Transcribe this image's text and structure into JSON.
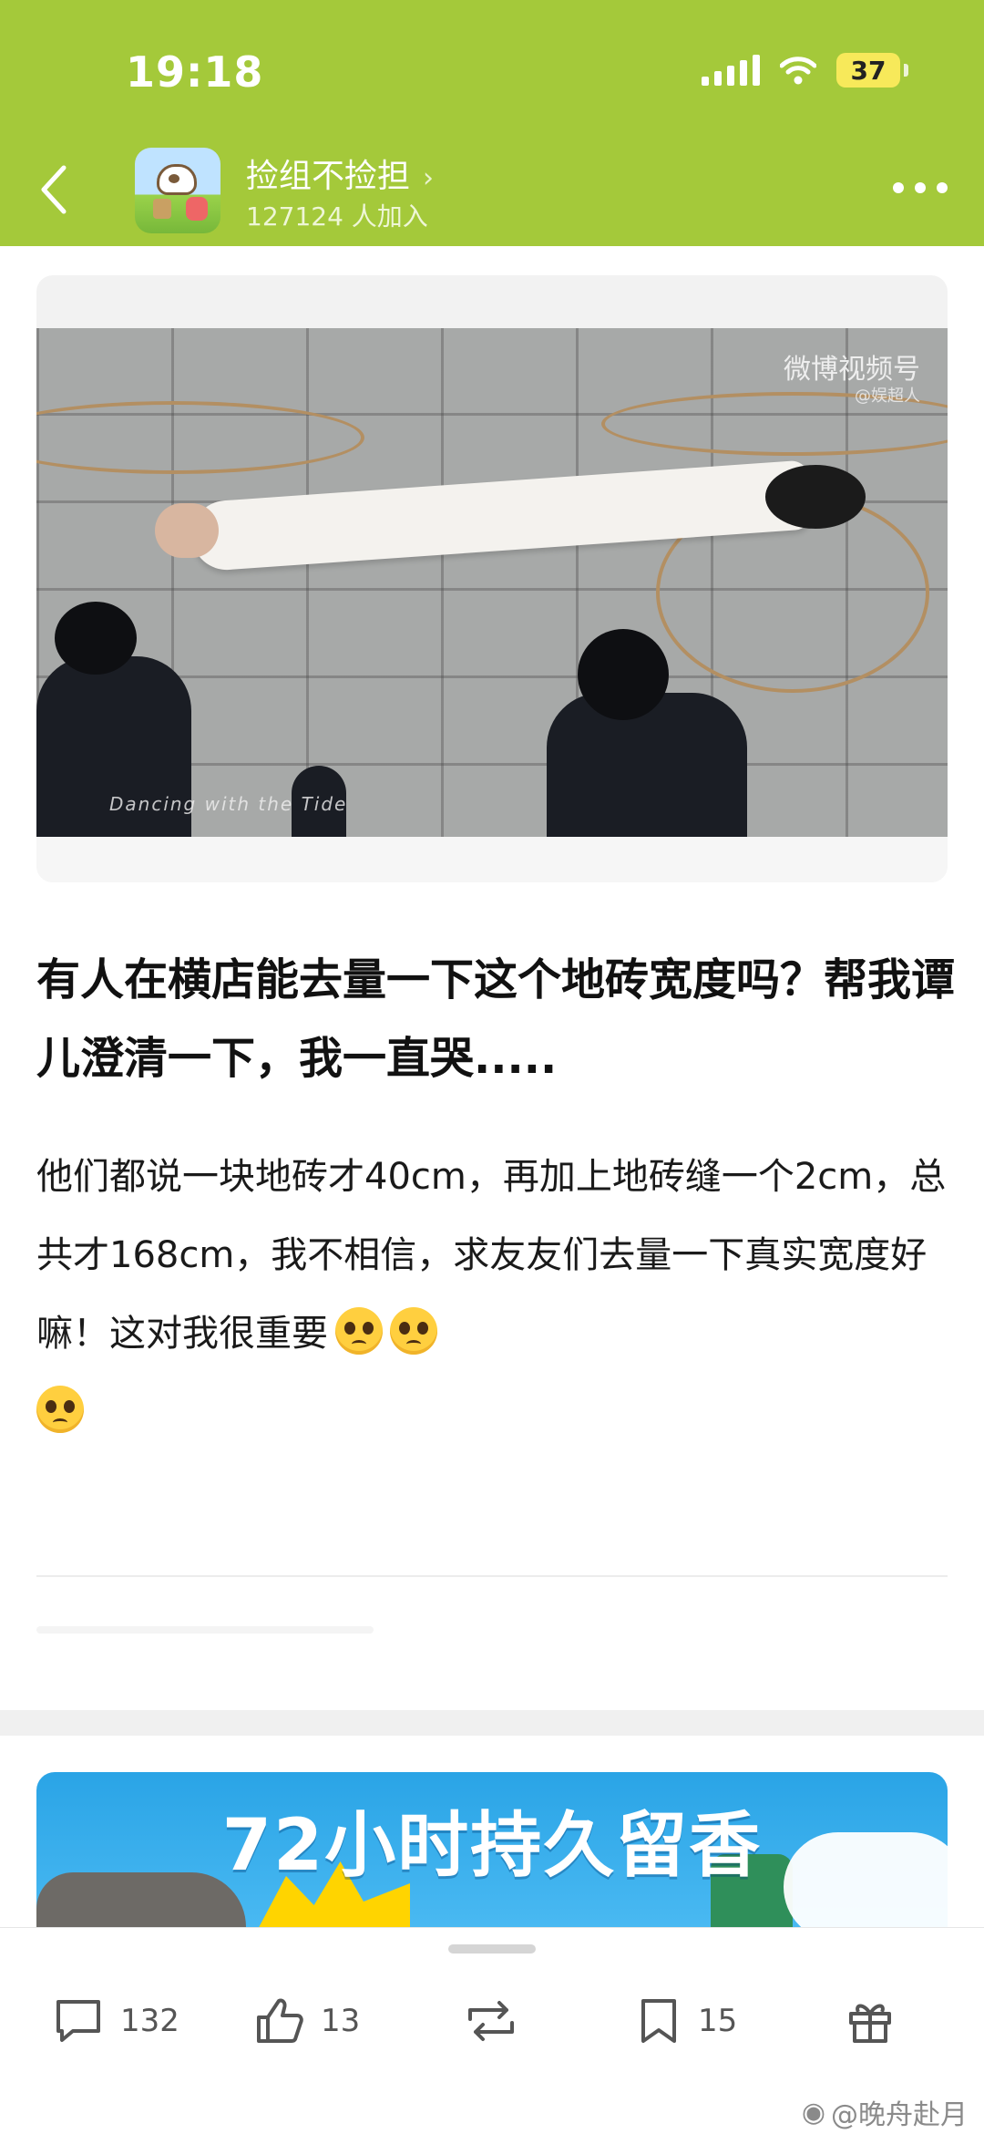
{
  "status_bar": {
    "time": "19:18",
    "battery": "37"
  },
  "group": {
    "name": "捡组不捡担",
    "member_count": "127124 人加入"
  },
  "media": {
    "watermark_brand": "微博视频号",
    "watermark_sub": "@娱超人",
    "photo_caption": "Dancing with the Tide"
  },
  "post": {
    "title": "有人在横店能去量一下这个地砖宽度吗？帮我谭儿澄清一下，我一直哭.....",
    "body": "他们都说一块地砖才40cm，再加上地砖缝一个2cm，总共才168cm，我不相信，求友友们去量一下真实宽度好嘛！这对我很重要",
    "emoji_names": [
      "pleading-face-emoji",
      "pleading-face-emoji",
      "pleading-face-emoji"
    ]
  },
  "ad": {
    "headline": "72小时持久留香"
  },
  "actions": {
    "comments": "132",
    "likes": "13",
    "repost_label": "",
    "favorites": "15",
    "gift_label": ""
  },
  "footer_watermark": "@晚舟赴月",
  "icons": {
    "back": "chevron-left-icon",
    "more": "more-dots-icon",
    "comment": "comment-bubble-icon",
    "like": "thumbs-up-icon",
    "repost": "repost-icon",
    "favorite": "bookmark-icon",
    "gift": "gift-icon"
  },
  "colors": {
    "header": "#a4c93a",
    "ad_background": "#2aa4e6",
    "text": "#111111"
  }
}
